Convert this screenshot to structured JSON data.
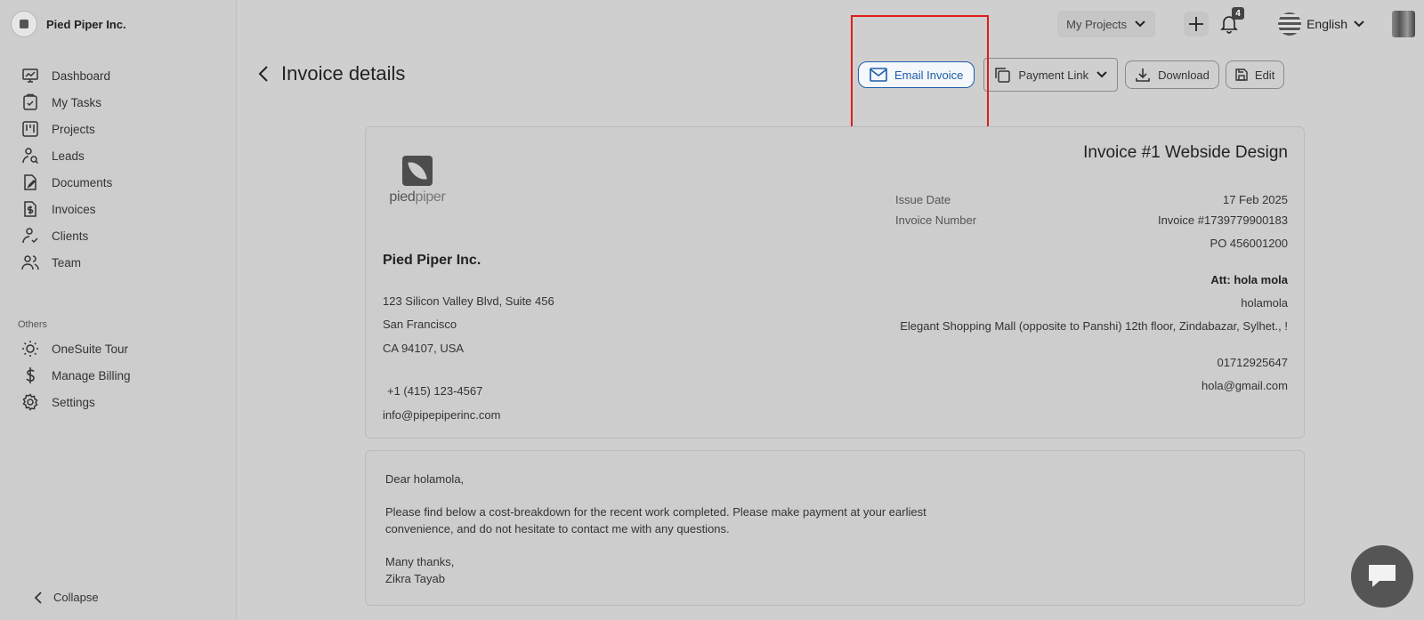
{
  "sidebar": {
    "brand_name": "Pied Piper Inc.",
    "items": [
      {
        "label": "Dashboard",
        "icon": "dashboard-icon"
      },
      {
        "label": "My Tasks",
        "icon": "tasks-icon"
      },
      {
        "label": "Projects",
        "icon": "projects-icon"
      },
      {
        "label": "Leads",
        "icon": "leads-icon"
      },
      {
        "label": "Documents",
        "icon": "documents-icon"
      },
      {
        "label": "Invoices",
        "icon": "invoices-icon"
      },
      {
        "label": "Clients",
        "icon": "clients-icon"
      },
      {
        "label": "Team",
        "icon": "team-icon"
      }
    ],
    "others_label": "Others",
    "others_items": [
      {
        "label": "OneSuite Tour",
        "icon": "sun-icon"
      },
      {
        "label": "Manage Billing",
        "icon": "dollar-icon"
      },
      {
        "label": "Settings",
        "icon": "gear-icon"
      }
    ],
    "collapse_label": "Collapse"
  },
  "topbar": {
    "projects_label": "My Projects",
    "notification_count": "4",
    "language": "English"
  },
  "header": {
    "title": "Invoice details",
    "email_invoice": "Email Invoice",
    "payment_link": "Payment Link",
    "download": "Download",
    "edit": "Edit"
  },
  "invoice": {
    "logo_text_a": "pied",
    "logo_text_b": "piper",
    "company_name": "Pied Piper Inc.",
    "address_line1": "123 Silicon Valley Blvd, Suite 456",
    "address_line2": "San Francisco",
    "address_line3": "CA 94107, USA",
    "phone": "+1 (415) 123-4567",
    "email": "info@pipepiperinc.com",
    "title": "Invoice #1 Webside Design",
    "issue_date_label": "Issue Date",
    "issue_date": "17 Feb 2025",
    "invoice_number_label": "Invoice Number",
    "invoice_number": "Invoice #1739779900183",
    "po": "PO 456001200",
    "att": "Att: hola mola",
    "client_name": "holamola",
    "client_address": "Elegant Shopping Mall (opposite to Panshi) 12th floor, Zindabazar, Sylhet., !",
    "client_phone": "01712925647",
    "client_email": "hola@gmail.com"
  },
  "message": {
    "greeting": "Dear holamola,",
    "body": "Please find below a cost-breakdown for the recent work completed. Please make payment at your earliest convenience, and do not hesitate to contact me with any questions.",
    "closing": "Many thanks,",
    "signature": "Zikra Tayab"
  }
}
